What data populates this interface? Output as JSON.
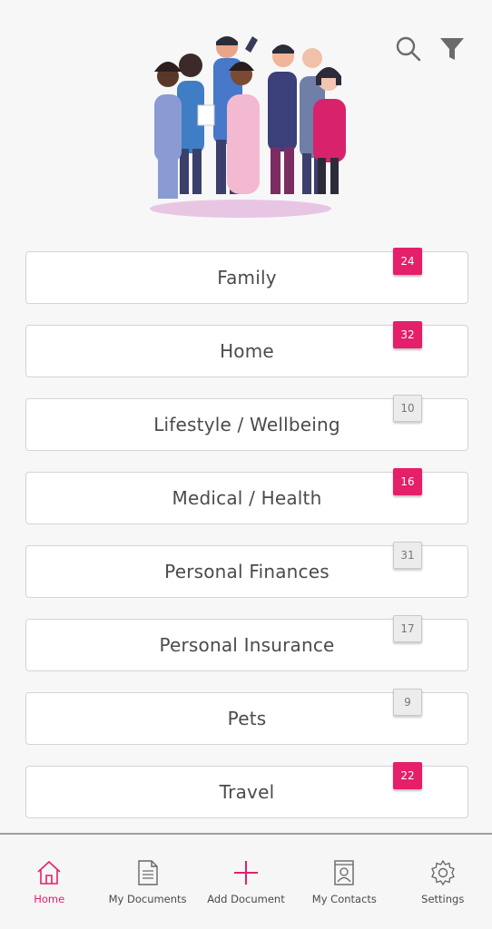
{
  "header": {
    "search_icon": "search-icon",
    "filter_icon": "filter-icon"
  },
  "categories": [
    {
      "label": "Family",
      "count": "24",
      "highlight": true
    },
    {
      "label": "Home",
      "count": "32",
      "highlight": true
    },
    {
      "label": "Lifestyle / Wellbeing",
      "count": "10",
      "highlight": false
    },
    {
      "label": "Medical / Health",
      "count": "16",
      "highlight": true
    },
    {
      "label": "Personal Finances",
      "count": "31",
      "highlight": false
    },
    {
      "label": "Personal Insurance",
      "count": "17",
      "highlight": false
    },
    {
      "label": "Pets",
      "count": "9",
      "highlight": false
    },
    {
      "label": "Travel",
      "count": "22",
      "highlight": true
    }
  ],
  "nav": {
    "home": "Home",
    "documents": "My Documents",
    "add": "Add Document",
    "contacts": "My Contacts",
    "settings": "Settings"
  },
  "colors": {
    "accent": "#e51f6a",
    "badge_grey": "#ececec",
    "text": "#4b4b4b"
  }
}
